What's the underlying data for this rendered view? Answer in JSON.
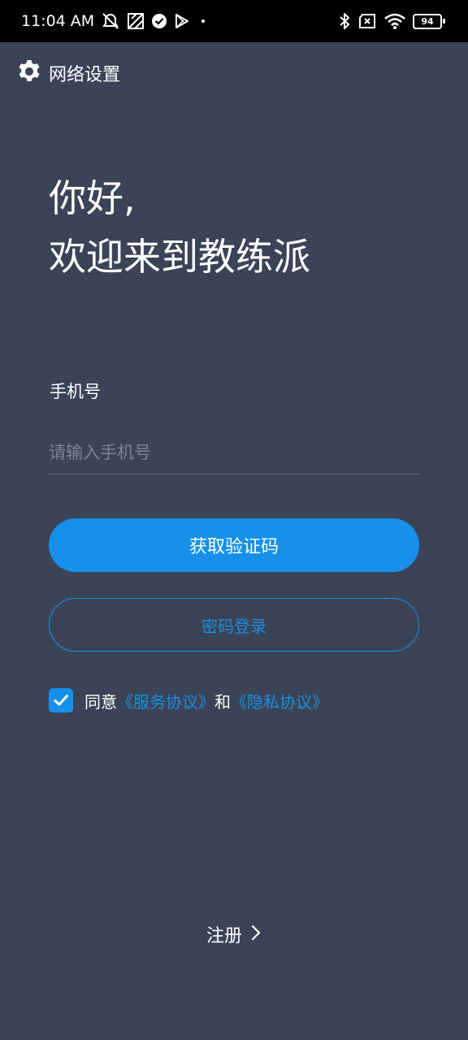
{
  "status_bar": {
    "time": "11:04 AM",
    "battery": "94",
    "icons": [
      "muted-alarm-icon",
      "notification-icon",
      "check-circle-icon",
      "play-store-icon",
      "dot-icon",
      "bluetooth-icon",
      "no-sim-icon",
      "wifi-icon",
      "battery-icon"
    ]
  },
  "header": {
    "network_settings_label": "网络设置",
    "icon": "gear-icon"
  },
  "greeting": {
    "line1": "你好,",
    "line2": "欢迎来到教练派"
  },
  "form": {
    "phone_label": "手机号",
    "phone_placeholder": "请输入手机号",
    "phone_value": "",
    "get_code_label": "获取验证码",
    "password_login_label": "密码登录"
  },
  "agreement": {
    "checked": true,
    "prefix": "同意",
    "service_link": "《服务协议》",
    "conjunction": "和",
    "privacy_link": "《隐私协议》"
  },
  "footer": {
    "register_label": "注册"
  },
  "colors": {
    "background": "#3b4357",
    "accent": "#1690ea",
    "link": "#1a8fe0"
  }
}
